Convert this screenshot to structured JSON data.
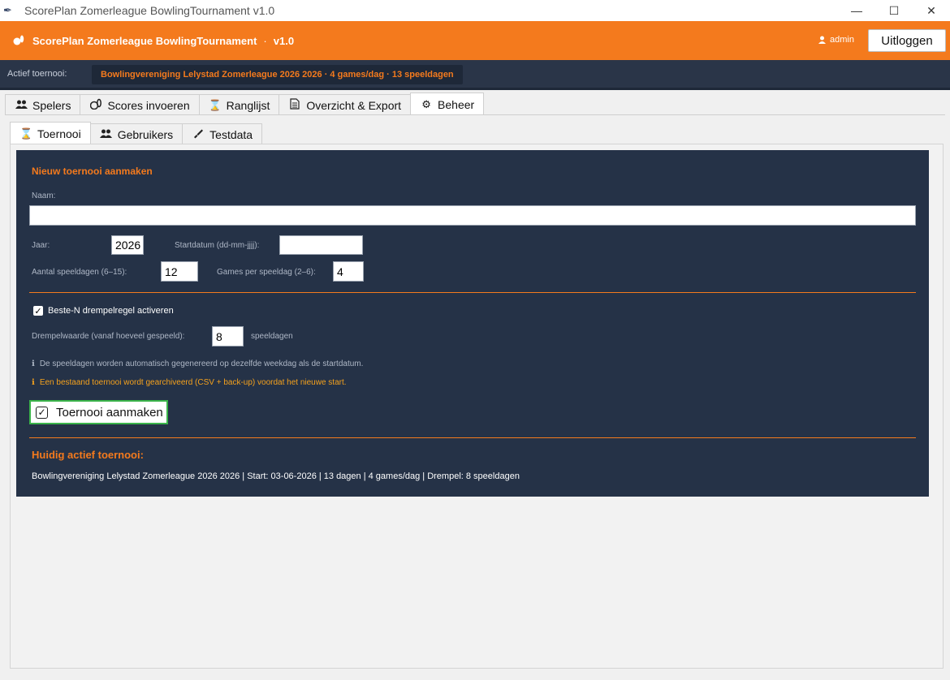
{
  "window": {
    "title": "ScorePlan Zomerleague BowlingTournament v1.0",
    "controls": [
      "minimize",
      "maximize",
      "close"
    ]
  },
  "header": {
    "app_title": "ScorePlan Zomerleague BowlingTournament",
    "separator": "·",
    "version": "v1.0",
    "user": "admin",
    "logout_label": "Uitloggen",
    "accent_color": "#f47a1d"
  },
  "active_bar": {
    "label": "Actief toernooi:",
    "value": "Bowlingvereniging Lelystad Zomerleague 2026 2026  ·  4 games/dag  ·  13 speeldagen"
  },
  "main_tabs": [
    {
      "label": "Spelers",
      "icon": "users-icon"
    },
    {
      "label": "Scores invoeren",
      "icon": "bowling-icon"
    },
    {
      "label": "Ranglijst",
      "icon": "hourglass-icon"
    },
    {
      "label": "Overzicht & Export",
      "icon": "document-icon"
    },
    {
      "label": "Beheer",
      "icon": "gear-icon",
      "active": true
    }
  ],
  "sub_tabs": [
    {
      "label": "Toernooi",
      "icon": "hourglass-icon",
      "active": true
    },
    {
      "label": "Gebruikers",
      "icon": "users-icon"
    },
    {
      "label": "Testdata",
      "icon": "brush-icon"
    }
  ],
  "form": {
    "section_title": "Nieuw toernooi aanmaken",
    "naam_label": "Naam:",
    "naam_value": "",
    "jaar_label": "Jaar:",
    "jaar_value": "2026",
    "startdatum_label": "Startdatum (dd-mm-jjjj):",
    "startdatum_value": "",
    "speeldagen_label": "Aantal speeldagen (6–15):",
    "speeldagen_value": "12",
    "games_label": "Games per speeldag (2–6):",
    "games_value": "4",
    "beste_n_label": "Beste-N drempelregel activeren",
    "beste_n_checked": true,
    "drempel_label": "Drempelwaarde (vanaf hoeveel gespeeld):",
    "drempel_value": "8",
    "drempel_unit": "speeldagen",
    "info1": "De speeldagen worden automatisch gegenereerd op dezelfde weekdag als de startdatum.",
    "info2": "Een bestaand toernooi wordt gearchiveerd (CSV + back-up) voordat het nieuwe start.",
    "info_icon": "ℹ",
    "create_button": "Toernooi aanmaken"
  },
  "current": {
    "title": "Huidig actief toernooi:",
    "details": "Bowlingvereniging Lelystad Zomerleague 2026 2026  |  Start: 03-06-2026  |  13 dagen  |  4 games/dag  |  Drempel: 8 speeldagen"
  },
  "colors": {
    "header_bg": "#f47a1d",
    "dark_bar": "#2a3548",
    "card_bg": "#253247",
    "info_muted": "#aeb7c6",
    "info_warning": "#f4a11d",
    "button_border": "#3bb44a"
  }
}
